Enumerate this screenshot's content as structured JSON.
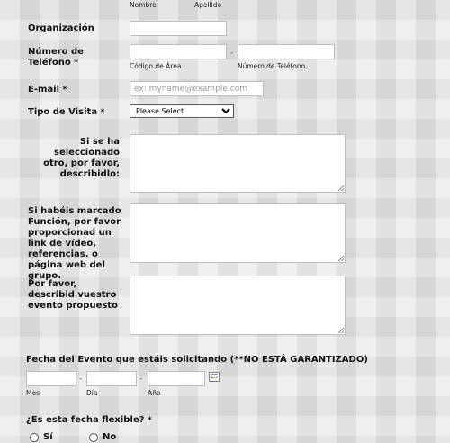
{
  "name": {
    "first_sub": "Nombre",
    "last_sub": "Apellido"
  },
  "organizacion": {
    "label": "Organización",
    "value": ""
  },
  "telefono": {
    "label": "Número de Teléfono",
    "required": "*",
    "area_sub": "Código de Área",
    "number_sub": "Número de Teléfono",
    "dash": "-"
  },
  "email": {
    "label": "E-mail",
    "required": "*",
    "placeholder": "ex: myname@example.com"
  },
  "tipo_visita": {
    "label": "Tipo de Visita",
    "required": "*",
    "selected": "Please Select"
  },
  "otro": {
    "label": "Si se ha seleccionado otro, por favor, describidlo:"
  },
  "funcion": {
    "label": "Si habéis marcado Función, por favor proporcionad un link de vídeo, referencias. o página web del grupo."
  },
  "evento": {
    "label": "Por favor, describid vuestro evento propuesto"
  },
  "fecha": {
    "label": "Fecha del Evento que estáis solicitando (**NO ESTÁ GARANTIZADO)",
    "mes_sub": "Mes",
    "dia_sub": "Día",
    "anio_sub": "Año",
    "dash": "-"
  },
  "flexible": {
    "label": "¿Es esta fecha flexible?",
    "required": "*",
    "options": [
      "Sí",
      "No"
    ]
  }
}
